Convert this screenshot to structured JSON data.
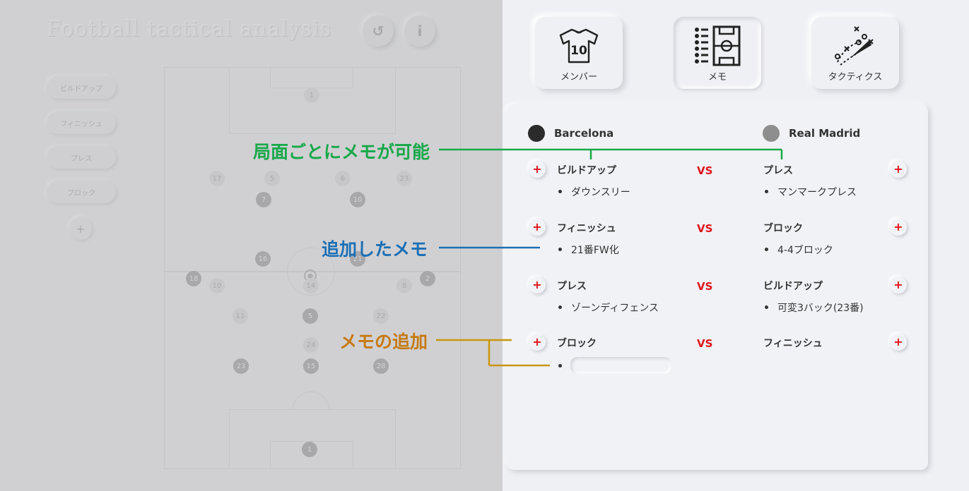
{
  "left": {
    "title": "Football tactical analysis",
    "undo_glyph": "↺",
    "info_glyph": "i",
    "phases": [
      "ビルドアップ",
      "フィニッシュ",
      "プレス",
      "ブロック"
    ],
    "add_glyph": "+",
    "players": [
      {
        "n": "1",
        "t": "light"
      },
      {
        "n": "17",
        "t": "light"
      },
      {
        "n": "5",
        "t": "light"
      },
      {
        "n": "6",
        "t": "light"
      },
      {
        "n": "23",
        "t": "light"
      },
      {
        "n": "7",
        "t": "dark"
      },
      {
        "n": "10",
        "t": "dark"
      },
      {
        "n": "16",
        "t": "dark"
      },
      {
        "n": "21",
        "t": "dark"
      },
      {
        "n": "18",
        "t": "dark"
      },
      {
        "n": "10",
        "t": "light"
      },
      {
        "n": "14",
        "t": "light"
      },
      {
        "n": "8",
        "t": "light"
      },
      {
        "n": "2",
        "t": "dark"
      },
      {
        "n": "11",
        "t": "light"
      },
      {
        "n": "5",
        "t": "dark"
      },
      {
        "n": "22",
        "t": "light"
      },
      {
        "n": "24",
        "t": "light"
      },
      {
        "n": "23",
        "t": "dark"
      },
      {
        "n": "15",
        "t": "dark"
      },
      {
        "n": "28",
        "t": "dark"
      },
      {
        "n": "1",
        "t": "dark"
      }
    ]
  },
  "toolbar": {
    "members_label": "メンバー",
    "members_shirt_number": "10",
    "memo_label": "メモ",
    "tactics_label": "タクティクス"
  },
  "teams": {
    "home": {
      "name": "Barcelona",
      "color": "#2b2b2b"
    },
    "away": {
      "name": "Real Madrid",
      "color": "#8e8e8e"
    }
  },
  "plus_glyph": "+",
  "matchups": [
    {
      "home_phase": "ビルドアップ",
      "home_memos": [
        "ダウンスリー"
      ],
      "vs": "VS",
      "away_phase": "プレス",
      "away_memos": [
        "マンマークプレス"
      ]
    },
    {
      "home_phase": "フィニッシュ",
      "home_memos": [
        "21番FW化"
      ],
      "vs": "VS",
      "away_phase": "ブロック",
      "away_memos": [
        "4-4ブロック"
      ]
    },
    {
      "home_phase": "プレス",
      "home_memos": [
        "ゾーンディフェンス"
      ],
      "vs": "VS",
      "away_phase": "ビルドアップ",
      "away_memos": [
        "可変3バック(23番)"
      ]
    },
    {
      "home_phase": "ブロック",
      "home_memos": [],
      "vs": "VS",
      "away_phase": "フィニッシュ",
      "away_memos": []
    }
  ],
  "memo_input": {
    "value": "",
    "placeholder": ""
  },
  "annotations": {
    "per_phase": {
      "text": "局面ごとにメモが可能",
      "color": "#18a84a"
    },
    "added": {
      "text": "追加したメモ",
      "color": "#1b6fb5"
    },
    "add_memo": {
      "text": "メモの追加",
      "color": "#c67a12",
      "line_color": "#c9970e"
    }
  }
}
